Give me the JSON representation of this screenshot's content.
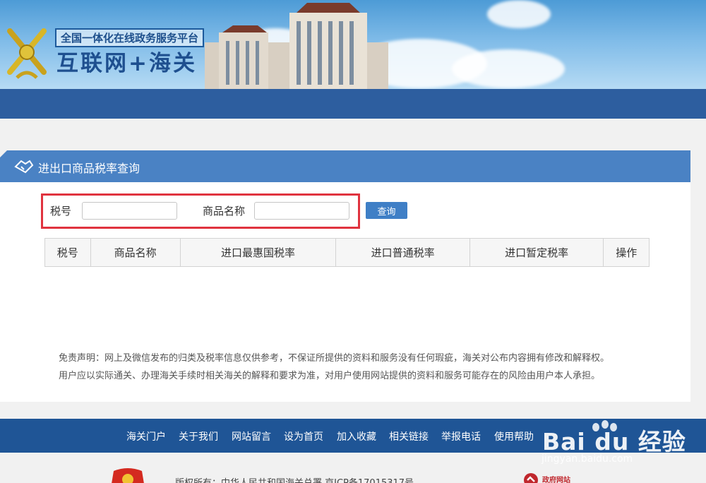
{
  "header": {
    "slogan": "全国一体化在线政务服务平台",
    "title": "互联网+海关"
  },
  "panel": {
    "title": "进出口商品税率查询"
  },
  "search": {
    "tax_label": "税号",
    "tax_value": "",
    "name_label": "商品名称",
    "name_value": "",
    "query_button": "查询"
  },
  "table": {
    "columns": [
      "税号",
      "商品名称",
      "进口最惠国税率",
      "进口普通税率",
      "进口暂定税率",
      "操作"
    ],
    "rows": []
  },
  "disclaimer": {
    "line1": "免责声明：网上及微信发布的归类及税率信息仅供参考，不保证所提供的资料和服务没有任何瑕疵，海关对公布内容拥有修改和解释权。",
    "line2": "用户应以实际通关、办理海关手续时相关海关的解释和要求为准，对用户使用网站提供的资料和服务可能存在的风险由用户本人承担。"
  },
  "footer": {
    "links": [
      "海关门户",
      "关于我们",
      "网站留言",
      "设为首页",
      "加入收藏",
      "相关链接",
      "举报电话",
      "使用帮助"
    ],
    "copyright": "版权所有：中华人民共和国海关总署 京ICP备17015317号",
    "gov_badge": "政府网站"
  },
  "watermark": {
    "text": "Bai du 经验",
    "url": "jingyan.baidu.com"
  },
  "colors": {
    "nav_blue": "#2d5e9f",
    "panel_blue": "#4a82c4",
    "footer_blue": "#1f5596",
    "highlight_red": "#e0333f"
  }
}
